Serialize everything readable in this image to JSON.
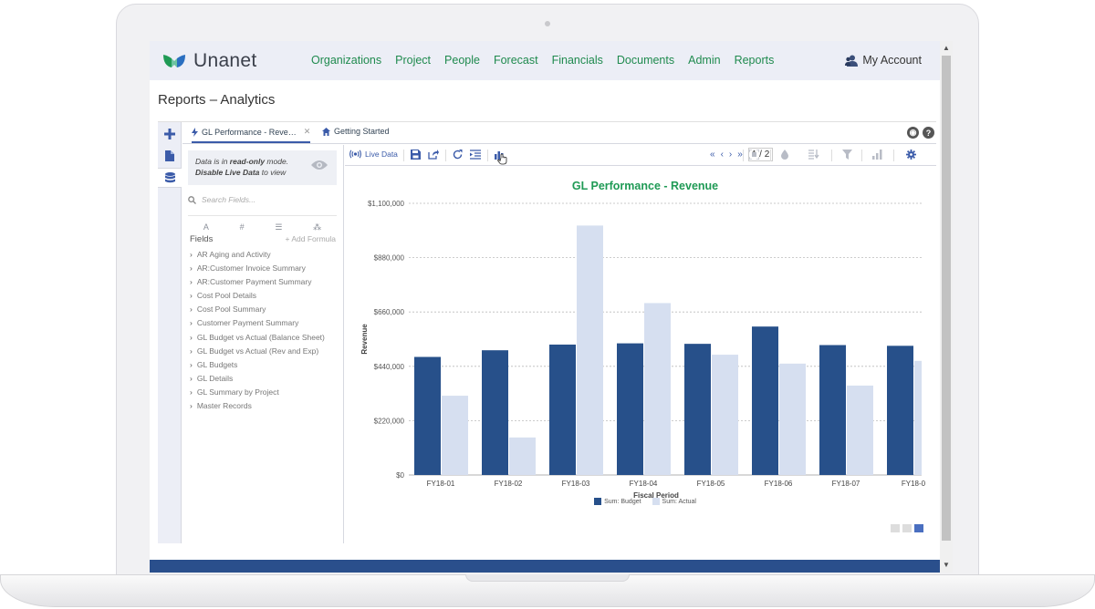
{
  "app": {
    "brand": "Unanet",
    "brand_colors": {
      "nav_green": "#1f8a4e",
      "primary_blue": "#2a4f8c",
      "chart_title_green": "#1f9a55"
    },
    "nav": [
      "Organizations",
      "Project",
      "People",
      "Forecast",
      "Financials",
      "Documents",
      "Admin",
      "Reports"
    ],
    "account_label": "My Account"
  },
  "page": {
    "title": "Reports – Analytics"
  },
  "tabs": [
    {
      "label": "GL Performance - Reve…",
      "icon": "bolt-icon",
      "active": true
    },
    {
      "label": "Getting Started",
      "icon": "home-icon",
      "active": false
    }
  ],
  "fields_panel": {
    "readonly_line1": "Data is in ",
    "readonly_em": "read-only",
    "readonly_line1_end": " mode.",
    "readonly_line2_bold": "Disable Live Data",
    "readonly_line2_end": " to view",
    "search_placeholder": "Search Fields...",
    "header": "Fields",
    "add_formula": "+ Add Formula",
    "items": [
      "AR Aging and Activity",
      "AR:Customer Invoice Summary",
      "AR:Customer Payment Summary",
      "Cost Pool Details",
      "Cost Pool Summary",
      "Customer Payment Summary",
      "GL Budget vs Actual (Balance Sheet)",
      "GL Budget vs Actual (Rev and Exp)",
      "GL Budgets",
      "GL Details",
      "GL Summary by Project",
      "Master Records"
    ]
  },
  "toolbar": {
    "live_data": "Live Data",
    "page_current": "1",
    "page_total": "2",
    "page_text": "1 / 2"
  },
  "chart_data": {
    "type": "bar",
    "title": "GL Performance - Revenue",
    "xlabel": "Fiscal Period",
    "ylabel": "Revenue",
    "ylim": [
      0,
      1100000
    ],
    "yticks": [
      "$0",
      "$220,000",
      "$440,000",
      "$660,000",
      "$880,000",
      "$1,100,000"
    ],
    "categories": [
      "FY18-01",
      "FY18-02",
      "FY18-03",
      "FY18-04",
      "FY18-05",
      "FY18-06",
      "FY18-07",
      "FY18-0"
    ],
    "series": [
      {
        "name": "Sum: Budget",
        "color": "#27508a",
        "values": [
          478000,
          505000,
          528000,
          533000,
          531000,
          601000,
          526000,
          523000
        ]
      },
      {
        "name": "Sum: Actual",
        "color": "#d6dff0",
        "values": [
          321000,
          152000,
          1010000,
          696000,
          487000,
          451000,
          362000,
          462000
        ]
      }
    ],
    "grid": true,
    "legend": "bottom"
  }
}
